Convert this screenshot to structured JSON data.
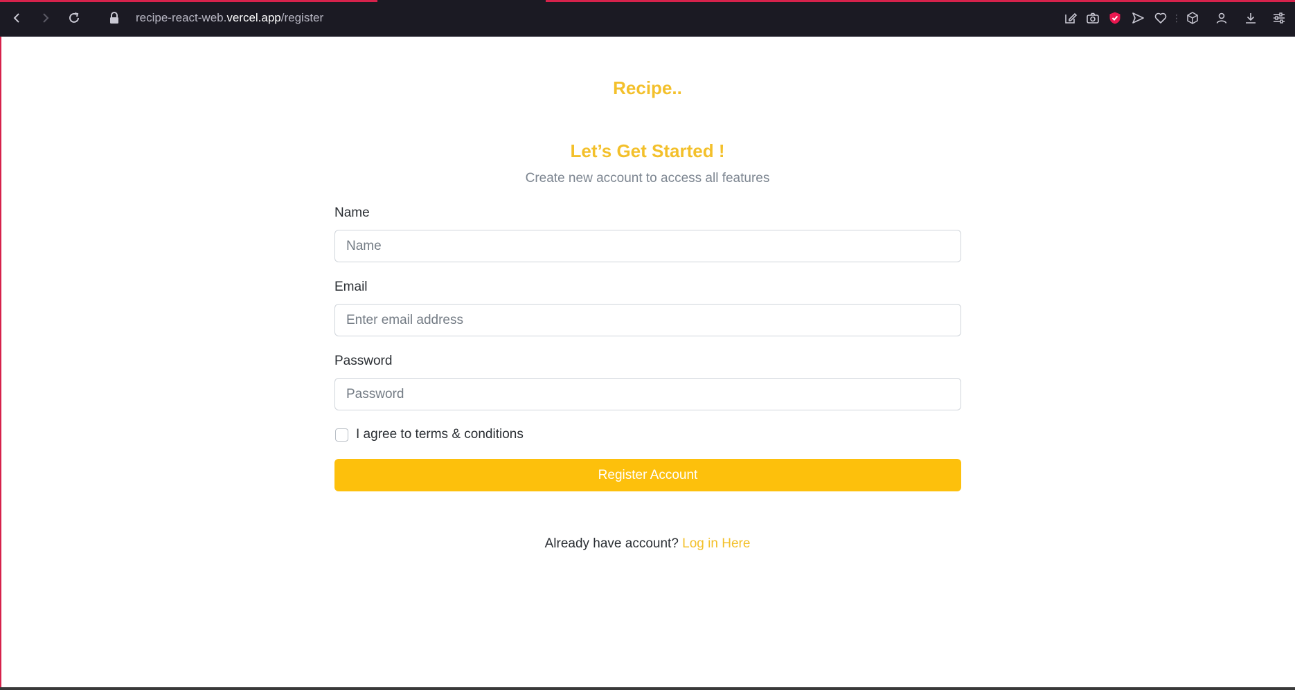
{
  "browser": {
    "url_host_prefix": "recipe-react-web.",
    "url_host_main": "vercel.app",
    "url_path": "/register"
  },
  "page": {
    "brand": "Recipe..",
    "headline": "Let’s Get Started !",
    "subline": "Create new account to access all features",
    "form": {
      "name_label": "Name",
      "name_placeholder": "Name",
      "email_label": "Email",
      "email_placeholder": "Enter email address",
      "password_label": "Password",
      "password_placeholder": "Password",
      "terms_label": "I agree to terms & conditions",
      "terms_checked": false,
      "submit_label": "Register Account"
    },
    "footer": {
      "prompt": "Already have account?",
      "login_link": "Log in Here"
    }
  },
  "colors": {
    "accent": "#f3c02b",
    "button": "#fdc00c",
    "chrome_bg": "#1b1a23",
    "chrome_accent": "#d6224b"
  },
  "toolbar_icons": [
    "snapshot-edit-icon",
    "camera-icon",
    "shield-icon",
    "send-icon",
    "heart-icon",
    "cube-icon",
    "profile-icon",
    "download-icon",
    "easy-setup-icon"
  ]
}
